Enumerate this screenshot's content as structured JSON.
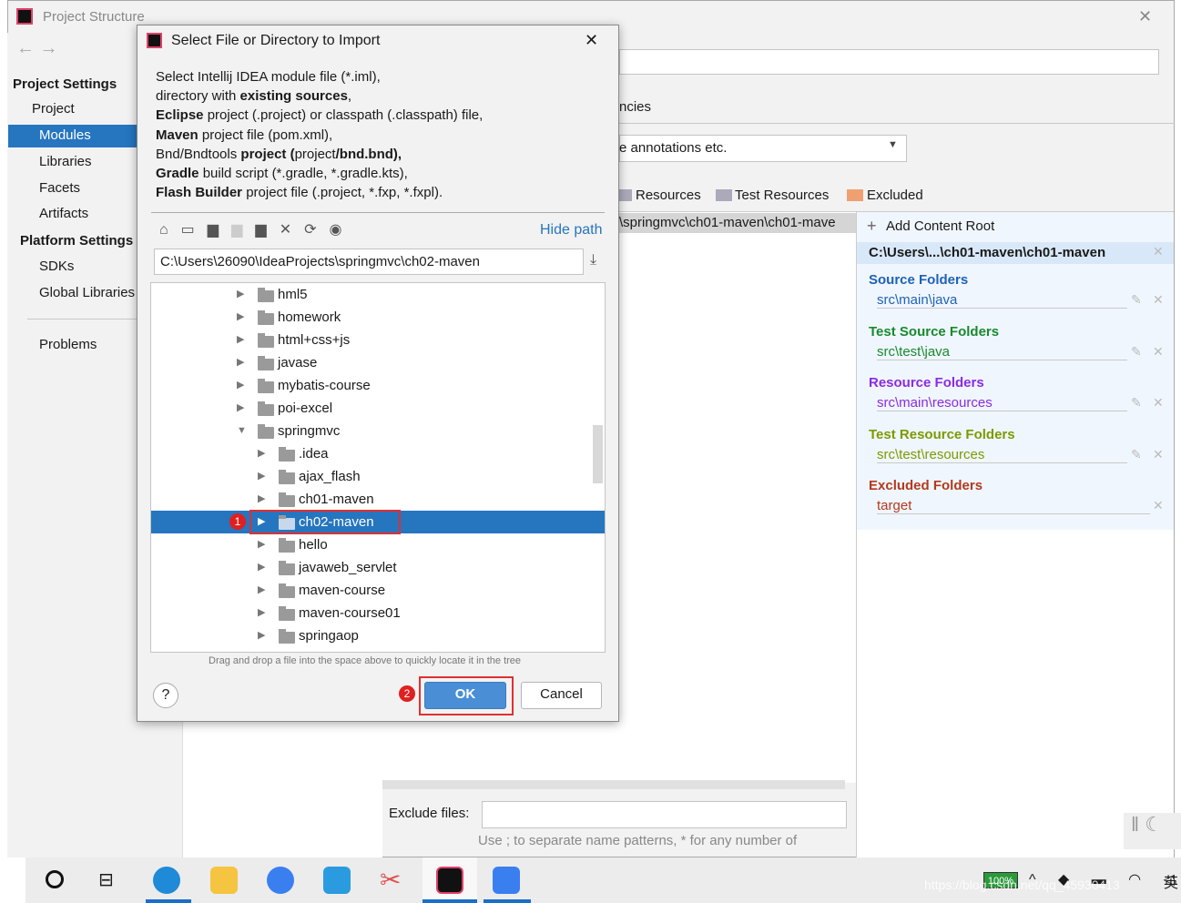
{
  "window": {
    "title": "Project Structure",
    "close": "✕"
  },
  "sidebar": {
    "project_settings": "Project Settings",
    "items": [
      "Project",
      "Modules",
      "Libraries",
      "Facets",
      "Artifacts"
    ],
    "platform_settings": "Platform Settings",
    "platform_items": [
      "SDKs",
      "Global Libraries"
    ],
    "problems": "Problems",
    "selected": "Modules"
  },
  "background": {
    "tab_fragment": "ncies",
    "dropdown_value": "e annotations etc.",
    "markers": [
      "Resources",
      "Test Resources",
      "Excluded"
    ],
    "tree_selected": "\\springmvc\\ch01-maven\\ch01-mave",
    "add_content_root": "Add Content Root",
    "content_root": "C:\\Users\\...\\ch01-maven\\ch01-maven",
    "folders": [
      {
        "title": "Source Folders",
        "path": "src\\main\\java",
        "color": "#1d62b8"
      },
      {
        "title": "Test Source Folders",
        "path": "src\\test\\java",
        "color": "#188a2e"
      },
      {
        "title": "Resource Folders",
        "path": "src\\main\\resources",
        "color": "#8a2be2"
      },
      {
        "title": "Test Resource Folders",
        "path": "src\\test\\resources",
        "color": "#7c9a00"
      },
      {
        "title": "Excluded Folders",
        "path": "target",
        "color": "#b23a1e"
      }
    ],
    "exclude_label": "Exclude files:",
    "exclude_hint": "Use ; to separate name patterns, * for any number of"
  },
  "dialog": {
    "title": "Select File or Directory to Import",
    "close": "✕",
    "description": [
      [
        "Select Intellij IDEA module file (*.iml),"
      ],
      [
        "directory with ",
        "existing sources",
        ","
      ],
      [
        "Eclipse",
        " project (.project) or classpath (.classpath) file,"
      ],
      [
        "Maven",
        " project file (pom.xml),"
      ],
      [
        "Bnd/Bndtools",
        " project (",
        "project",
        "/bnd.bnd),"
      ],
      [
        "Gradle",
        " build script (*.gradle, *.gradle.kts),"
      ],
      [
        "Flash Builder",
        " project file (.project, *.fxp, *.fxpl)."
      ]
    ],
    "hide_path": "Hide path",
    "path_value": "C:\\Users\\26090\\IdeaProjects\\springmvc\\ch02-maven",
    "tree": [
      {
        "name": "hml5",
        "level": 1,
        "expanded": false
      },
      {
        "name": "homework",
        "level": 1,
        "expanded": false
      },
      {
        "name": "html+css+js",
        "level": 1,
        "expanded": false
      },
      {
        "name": "javase",
        "level": 1,
        "expanded": false
      },
      {
        "name": "mybatis-course",
        "level": 1,
        "expanded": false
      },
      {
        "name": "poi-excel",
        "level": 1,
        "expanded": false
      },
      {
        "name": "springmvc",
        "level": 1,
        "expanded": true
      },
      {
        "name": ".idea",
        "level": 2,
        "expanded": false
      },
      {
        "name": "ajax_flash",
        "level": 2,
        "expanded": false
      },
      {
        "name": "ch01-maven",
        "level": 2,
        "expanded": false
      },
      {
        "name": "ch02-maven",
        "level": 2,
        "expanded": false,
        "selected": true
      },
      {
        "name": "hello",
        "level": 2,
        "expanded": false
      },
      {
        "name": "javaweb_servlet",
        "level": 2,
        "expanded": false
      },
      {
        "name": "maven-course",
        "level": 2,
        "expanded": false
      },
      {
        "name": "maven-course01",
        "level": 2,
        "expanded": false
      },
      {
        "name": "springaop",
        "level": 2,
        "expanded": false
      }
    ],
    "drag_hint": "Drag and drop a file into the space above to quickly locate it in the tree",
    "help": "?",
    "ok": "OK",
    "cancel": "Cancel",
    "badge1": "1",
    "badge2": "2"
  },
  "taskbar": {
    "battery": "100%",
    "ime": "英",
    "watermark": "https://blog.csdn.net/qq_45930413"
  },
  "colors": {
    "accent": "#2675bf",
    "annotation": "#e03030"
  }
}
